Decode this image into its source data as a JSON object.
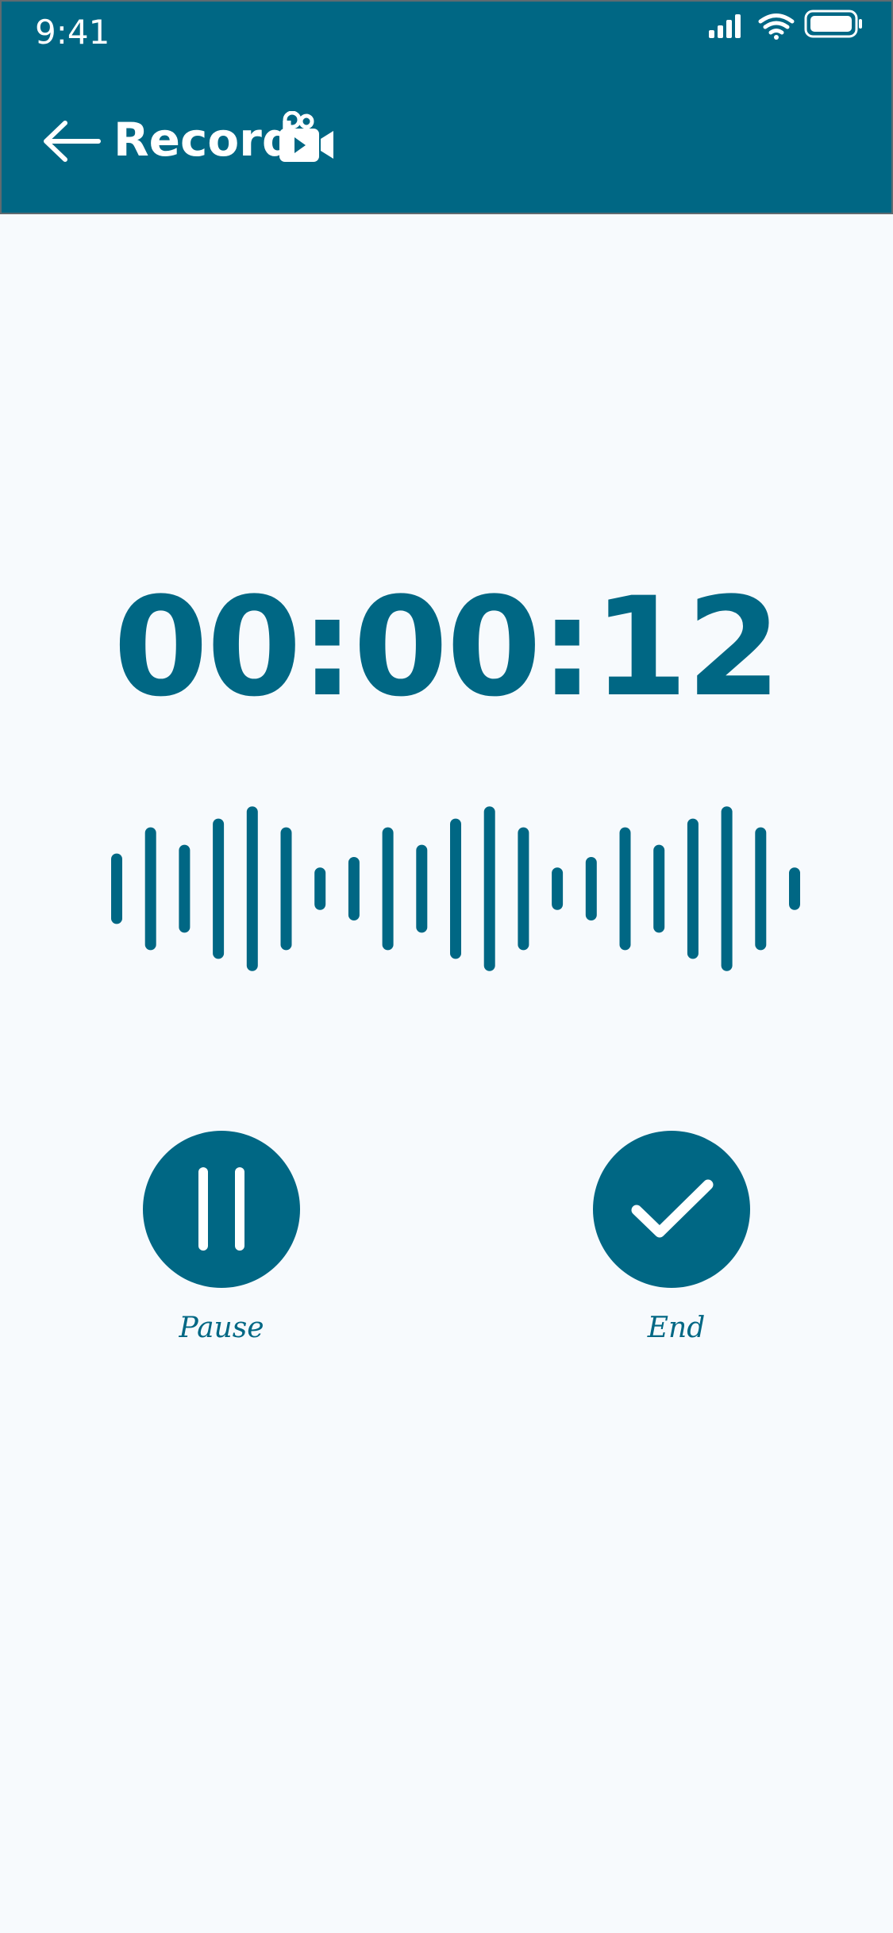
{
  "status_bar": {
    "time": "9:41",
    "icons": [
      "signal-icon",
      "wifi-icon",
      "battery-icon"
    ]
  },
  "header": {
    "title": "Record",
    "back_icon": "arrow-left-icon",
    "title_icon": "video-camera-icon"
  },
  "timer": {
    "value": "00:00:12"
  },
  "waveform": {
    "bar_levels": [
      0.34,
      0.64,
      0.44,
      0.74,
      0.88,
      0.64,
      0.18,
      0.3,
      0.64,
      0.44,
      0.74,
      0.88,
      0.64,
      0.18,
      0.3,
      0.64,
      0.44,
      0.74,
      0.88,
      0.64,
      0.18
    ]
  },
  "controls": {
    "pause_label": "Pause",
    "end_label": "End",
    "pause_icon": "pause-icon",
    "end_icon": "checkmark-icon"
  },
  "colors": {
    "primary": "#006784",
    "background": "#f7fafd",
    "on_primary": "#ffffff"
  }
}
